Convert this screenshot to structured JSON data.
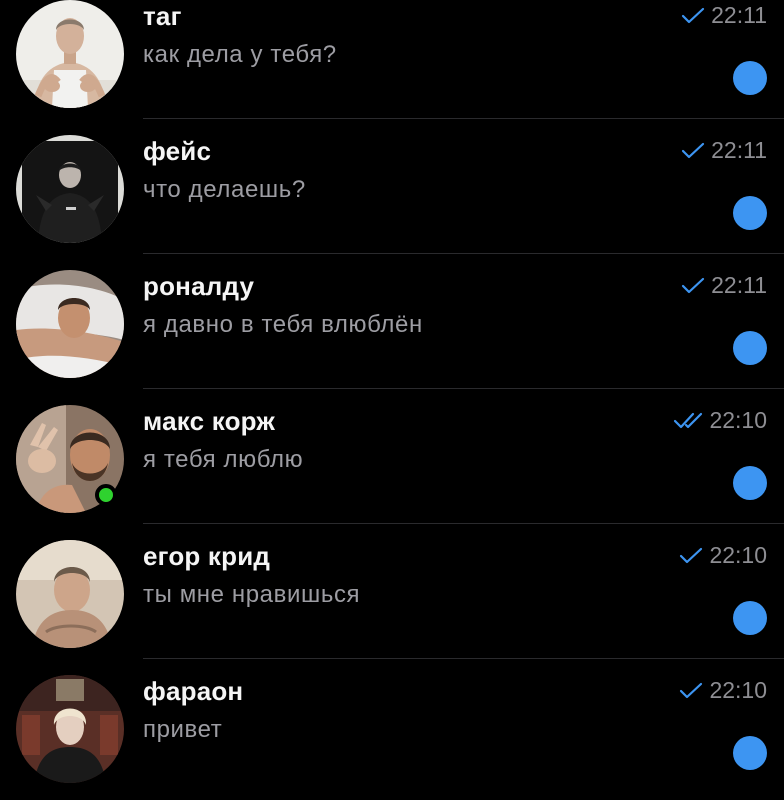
{
  "chats": [
    {
      "name": "таг",
      "preview": "как дела у тебя?",
      "time": "22:11",
      "receipt": "single-check",
      "online": false,
      "unread": true,
      "avatar_icon": "shirtless-man-avatar"
    },
    {
      "name": "фейс",
      "preview": "что делаешь?",
      "time": "22:11",
      "receipt": "single-check",
      "online": false,
      "unread": true,
      "avatar_icon": "dark-portrait-avatar"
    },
    {
      "name": "роналду",
      "preview": "я давно в тебя влюблён",
      "time": "22:11",
      "receipt": "single-check",
      "online": false,
      "unread": true,
      "avatar_icon": "man-on-pillow-avatar"
    },
    {
      "name": "макс корж",
      "preview": "я тебя люблю",
      "time": "22:10",
      "receipt": "double-check",
      "online": true,
      "unread": true,
      "avatar_icon": "bearded-man-avatar"
    },
    {
      "name": "егор крид",
      "preview": "ты мне нравишься",
      "time": "22:10",
      "receipt": "single-check",
      "online": false,
      "unread": true,
      "avatar_icon": "selfie-man-avatar"
    },
    {
      "name": "фараон",
      "preview": "привет",
      "time": "22:10",
      "receipt": "single-check",
      "online": false,
      "unread": true,
      "avatar_icon": "blond-man-avatar"
    }
  ],
  "colors": {
    "background": "#000000",
    "name": "#f5f5f5",
    "preview": "#9d9da3",
    "time": "#8e8e93",
    "checkmark": "#3d95f2",
    "unread_badge": "#3d95f2",
    "online_indicator": "#2fd22f",
    "separator": "#2a2a2d"
  }
}
